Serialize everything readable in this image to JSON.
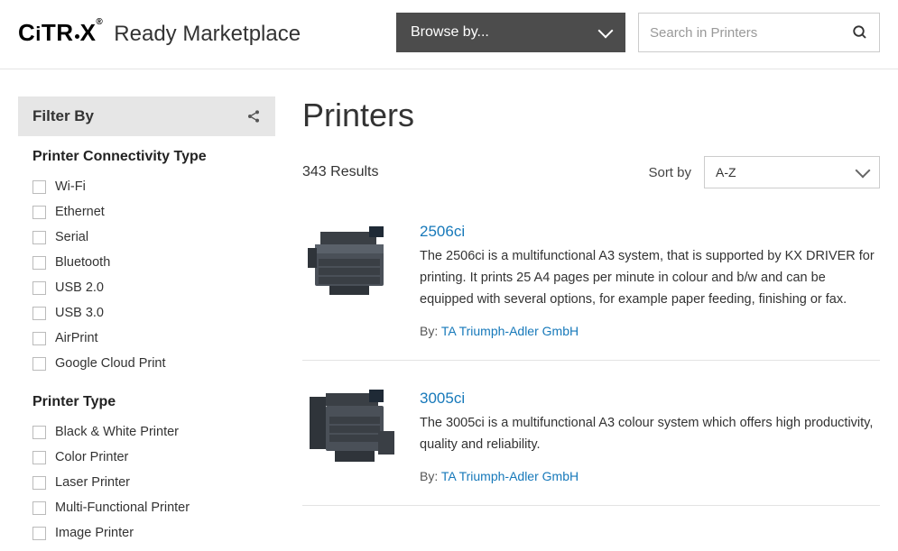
{
  "header": {
    "logo_brand": "CITRIX",
    "logo_suffix": "Ready Marketplace",
    "browse_label": "Browse by...",
    "search_placeholder": "Search in Printers"
  },
  "sidebar": {
    "filter_heading": "Filter By",
    "groups": [
      {
        "title": "Printer Connectivity Type",
        "items": [
          "Wi-Fi",
          "Ethernet",
          "Serial",
          "Bluetooth",
          "USB 2.0",
          "USB 3.0",
          "AirPrint",
          "Google Cloud Print"
        ]
      },
      {
        "title": "Printer Type",
        "items": [
          "Black & White Printer",
          "Color Printer",
          "Laser Printer",
          "Multi-Functional Printer",
          "Image Printer"
        ]
      }
    ]
  },
  "main": {
    "title": "Printers",
    "results_label": "343 Results",
    "sort_label": "Sort by",
    "sort_value": "A-Z",
    "by_prefix": "By: ",
    "cards": [
      {
        "title": "2506ci",
        "desc": "The 2506ci is a multifunctional A3 system, that is supported by KX DRIVER for printing. It prints 25 A4 pages per minute in colour and b/w and can be equipped with several options, for example paper feeding, finishing or fax.",
        "vendor": "TA Triumph-Adler GmbH"
      },
      {
        "title": "3005ci",
        "desc": "The 3005ci is a multifunctional A3 colour system which offers high productivity, quality and reliability.",
        "vendor": "TA Triumph-Adler GmbH"
      }
    ]
  }
}
